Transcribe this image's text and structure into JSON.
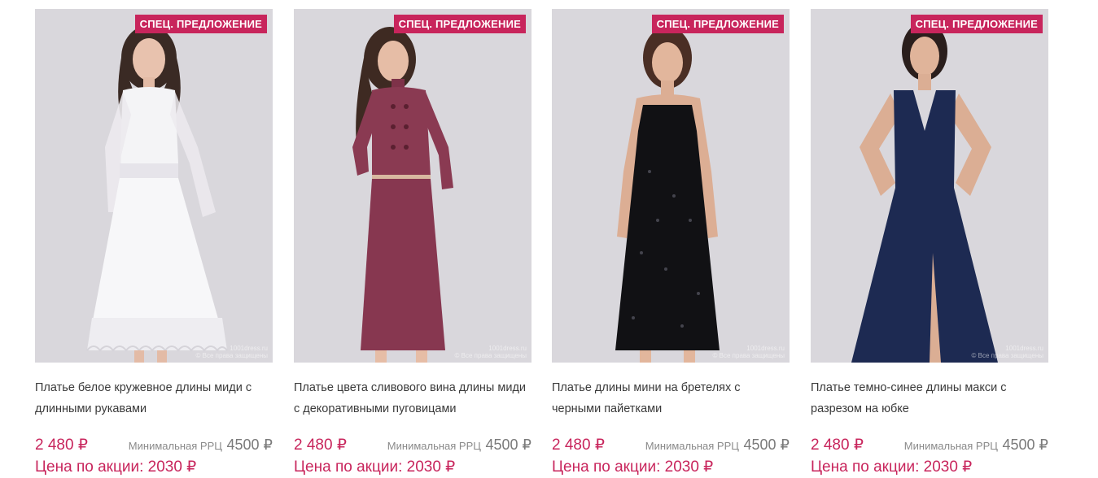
{
  "colors": {
    "accent": "#c8255c",
    "badge_bg": "#c8255c",
    "photo_bg": "#d9d7dc"
  },
  "products": [
    {
      "badge": "СПЕЦ. ПРЕДЛОЖЕНИЕ",
      "title": "Платье белое кружевное длины миди с длинными рукавами",
      "price": "2 480 ₽",
      "rrp_label": "Минимальная РРЦ",
      "rrp_value": "4500 ₽",
      "promo": "Цена по акции: 2030 ₽",
      "watermark": "1001dress.ru\n© Все права защищены",
      "dress_color": "#f4f4f6",
      "dress_style": "white-midi"
    },
    {
      "badge": "СПЕЦ. ПРЕДЛОЖЕНИЕ",
      "title": "Платье цвета сливового вина длины миди с декоративными пуговицами",
      "price": "2 480 ₽",
      "rrp_label": "Минимальная РРЦ",
      "rrp_value": "4500 ₽",
      "promo": "Цена по акции: 2030 ₽",
      "watermark": "1001dress.ru\n© Все права защищены",
      "dress_color": "#8a3a52",
      "dress_style": "plum-midi"
    },
    {
      "badge": "СПЕЦ. ПРЕДЛОЖЕНИЕ",
      "title": "Платье длины мини на бретелях с черными пайетками",
      "price": "2 480 ₽",
      "rrp_label": "Минимальная РРЦ",
      "rrp_value": "4500 ₽",
      "promo": "Цена по акции: 2030 ₽",
      "watermark": "1001dress.ru\n© Все права защищены",
      "dress_color": "#111114",
      "dress_style": "black-mini"
    },
    {
      "badge": "СПЕЦ. ПРЕДЛОЖЕНИЕ",
      "title": "Платье темно-синее длины макси с разрезом на юбке",
      "price": "2 480 ₽",
      "rrp_label": "Минимальная РРЦ",
      "rrp_value": "4500 ₽",
      "promo": "Цена по акции: 2030 ₽",
      "watermark": "1001dress.ru\n© Все права защищены",
      "dress_color": "#1d2a52",
      "dress_style": "navy-maxi"
    }
  ]
}
